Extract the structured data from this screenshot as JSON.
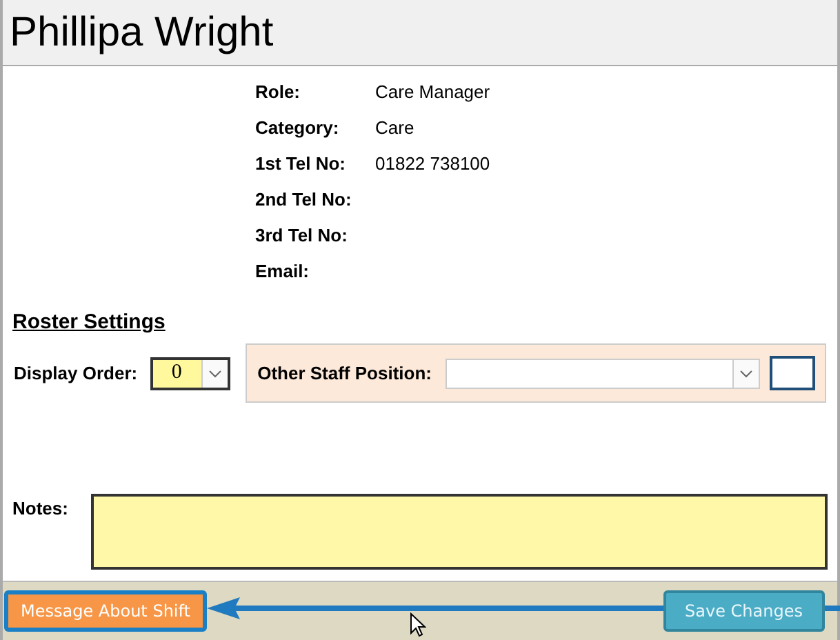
{
  "title": "Phillipa Wright",
  "details": [
    {
      "label": "Role:",
      "value": "Care Manager"
    },
    {
      "label": "Category:",
      "value": "Care"
    },
    {
      "label": "1st Tel No:",
      "value": "01822 738100"
    },
    {
      "label": "2nd Tel No:"
    },
    {
      "label": "3rd Tel No:"
    },
    {
      "label": "Email:"
    }
  ],
  "roster_settings": {
    "heading": "Roster Settings",
    "display_order": {
      "label": "Display Order:",
      "value": "0"
    },
    "other_staff_position": {
      "label": "Other Staff Position:"
    }
  },
  "notes": {
    "label": "Notes:"
  },
  "buttons": [
    {
      "label": "Message About Shift",
      "kind": "highlighted"
    },
    {
      "label": "Save Changes",
      "kind": "teal"
    }
  ]
}
